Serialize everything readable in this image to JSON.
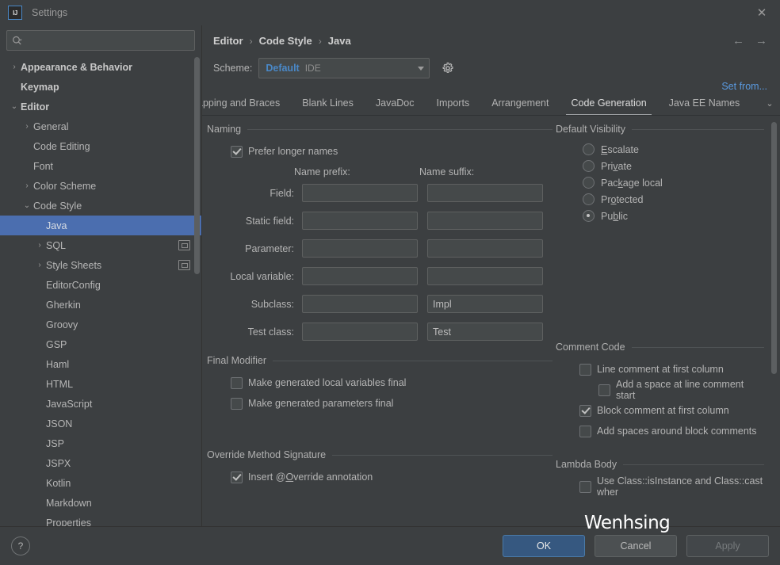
{
  "window": {
    "title": "Settings",
    "logo_text": "IJ",
    "close_label": "✕"
  },
  "sidebar": {
    "search": {
      "placeholder": "",
      "value": "",
      "icon": "search-icon"
    },
    "items": [
      {
        "label": "Appearance & Behavior",
        "twisty": "›",
        "indent": 0,
        "bold": true,
        "selected": false,
        "badge": false
      },
      {
        "label": "Keymap",
        "twisty": "",
        "indent": 0,
        "bold": true,
        "selected": false,
        "badge": false
      },
      {
        "label": "Editor",
        "twisty": "⌄",
        "indent": 0,
        "bold": true,
        "selected": false,
        "badge": false
      },
      {
        "label": "General",
        "twisty": "›",
        "indent": 1,
        "bold": false,
        "selected": false,
        "badge": false
      },
      {
        "label": "Code Editing",
        "twisty": "",
        "indent": 1,
        "bold": false,
        "selected": false,
        "badge": false
      },
      {
        "label": "Font",
        "twisty": "",
        "indent": 1,
        "bold": false,
        "selected": false,
        "badge": false
      },
      {
        "label": "Color Scheme",
        "twisty": "›",
        "indent": 1,
        "bold": false,
        "selected": false,
        "badge": false
      },
      {
        "label": "Code Style",
        "twisty": "⌄",
        "indent": 1,
        "bold": false,
        "selected": false,
        "badge": false
      },
      {
        "label": "Java",
        "twisty": "",
        "indent": 2,
        "bold": false,
        "selected": true,
        "badge": false
      },
      {
        "label": "SQL",
        "twisty": "›",
        "indent": 2,
        "bold": false,
        "selected": false,
        "badge": true
      },
      {
        "label": "Style Sheets",
        "twisty": "›",
        "indent": 2,
        "bold": false,
        "selected": false,
        "badge": true
      },
      {
        "label": "EditorConfig",
        "twisty": "",
        "indent": 2,
        "bold": false,
        "selected": false,
        "badge": false
      },
      {
        "label": "Gherkin",
        "twisty": "",
        "indent": 2,
        "bold": false,
        "selected": false,
        "badge": false
      },
      {
        "label": "Groovy",
        "twisty": "",
        "indent": 2,
        "bold": false,
        "selected": false,
        "badge": false
      },
      {
        "label": "GSP",
        "twisty": "",
        "indent": 2,
        "bold": false,
        "selected": false,
        "badge": false
      },
      {
        "label": "Haml",
        "twisty": "",
        "indent": 2,
        "bold": false,
        "selected": false,
        "badge": false
      },
      {
        "label": "HTML",
        "twisty": "",
        "indent": 2,
        "bold": false,
        "selected": false,
        "badge": false
      },
      {
        "label": "JavaScript",
        "twisty": "",
        "indent": 2,
        "bold": false,
        "selected": false,
        "badge": false
      },
      {
        "label": "JSON",
        "twisty": "",
        "indent": 2,
        "bold": false,
        "selected": false,
        "badge": false
      },
      {
        "label": "JSP",
        "twisty": "",
        "indent": 2,
        "bold": false,
        "selected": false,
        "badge": false
      },
      {
        "label": "JSPX",
        "twisty": "",
        "indent": 2,
        "bold": false,
        "selected": false,
        "badge": false
      },
      {
        "label": "Kotlin",
        "twisty": "",
        "indent": 2,
        "bold": false,
        "selected": false,
        "badge": false
      },
      {
        "label": "Markdown",
        "twisty": "",
        "indent": 2,
        "bold": false,
        "selected": false,
        "badge": false
      },
      {
        "label": "Properties",
        "twisty": "",
        "indent": 2,
        "bold": false,
        "selected": false,
        "badge": false
      }
    ]
  },
  "header": {
    "breadcrumb": [
      "Editor",
      "Code Style",
      "Java"
    ],
    "separator": "›",
    "back_arrow": "←",
    "forward_arrow": "→",
    "scheme_label": "Scheme:",
    "scheme_value": "Default",
    "scheme_scope": "IDE",
    "set_from_label": "Set from...",
    "gear_icon": "gear-icon"
  },
  "tabs": {
    "more_icon": "⌄",
    "items": [
      {
        "label": "apping and Braces",
        "active": false,
        "clipped": true
      },
      {
        "label": "Blank Lines",
        "active": false,
        "clipped": false
      },
      {
        "label": "JavaDoc",
        "active": false,
        "clipped": false
      },
      {
        "label": "Imports",
        "active": false,
        "clipped": false
      },
      {
        "label": "Arrangement",
        "active": false,
        "clipped": false
      },
      {
        "label": "Code Generation",
        "active": true,
        "clipped": false
      },
      {
        "label": "Java EE Names",
        "active": false,
        "clipped": false
      }
    ]
  },
  "naming": {
    "group_title": "Naming",
    "prefer_longer_names": {
      "label": "Prefer longer names",
      "checked": true
    },
    "col_prefix": "Name prefix:",
    "col_suffix": "Name suffix:",
    "rows": [
      {
        "label": "Field:",
        "prefix": "",
        "suffix": ""
      },
      {
        "label": "Static field:",
        "prefix": "",
        "suffix": ""
      },
      {
        "label": "Parameter:",
        "prefix": "",
        "suffix": ""
      },
      {
        "label": "Local variable:",
        "prefix": "",
        "suffix": ""
      },
      {
        "label": "Subclass:",
        "prefix": "",
        "suffix": "Impl"
      },
      {
        "label": "Test class:",
        "prefix": "",
        "suffix": "Test"
      }
    ]
  },
  "default_visibility": {
    "group_title": "Default Visibility",
    "options": [
      {
        "label": "Escalate",
        "mnemonic": "E",
        "selected": false
      },
      {
        "label": "Private",
        "mnemonic": "v",
        "selected": false
      },
      {
        "label": "Package local",
        "mnemonic": "k",
        "selected": false
      },
      {
        "label": "Protected",
        "mnemonic": "o",
        "selected": false
      },
      {
        "label": "Public",
        "mnemonic": "b",
        "selected": true
      }
    ]
  },
  "final_modifier": {
    "group_title": "Final Modifier",
    "options": [
      {
        "label": "Make generated local variables final",
        "checked": false
      },
      {
        "label": "Make generated parameters final",
        "checked": false
      }
    ]
  },
  "comment_code": {
    "group_title": "Comment Code",
    "options": [
      {
        "label": "Line comment at first column",
        "checked": false,
        "indent": 1
      },
      {
        "label": "Add a space at line comment start",
        "checked": false,
        "indent": 2
      },
      {
        "label": "Block comment at first column",
        "checked": true,
        "indent": 1
      },
      {
        "label": "Add spaces around block comments",
        "checked": false,
        "indent": 1
      }
    ]
  },
  "override_method_signature": {
    "group_title": "Override Method Signature",
    "options": [
      {
        "label": "Insert @Override annotation",
        "checked": true
      }
    ]
  },
  "lambda_body": {
    "group_title": "Lambda Body",
    "options": [
      {
        "label": "Use Class::isInstance and Class::cast wher",
        "checked": false
      }
    ]
  },
  "footer": {
    "help_label": "?",
    "ok_label": "OK",
    "cancel_label": "Cancel",
    "apply_label": "Apply"
  },
  "watermark": {
    "text": "Wenhsing"
  },
  "colors": {
    "accent_blue": "#4a88c7",
    "selection_blue": "#4b6eaf",
    "primary_button": "#365880",
    "link_blue": "#5a9ae0",
    "panel_bg": "#3c3f41",
    "field_bg": "#45494a"
  }
}
